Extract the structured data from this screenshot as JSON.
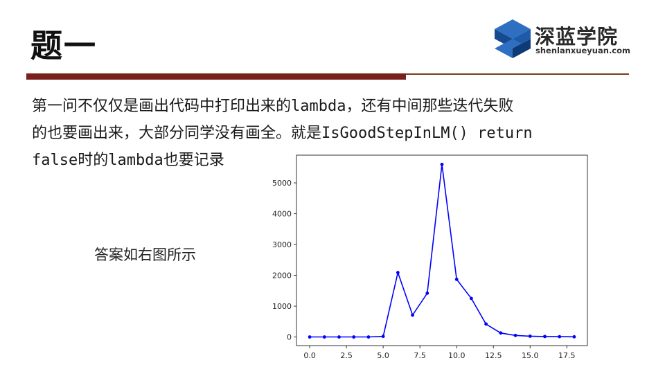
{
  "header": {
    "title": "题一",
    "logo_name": "深蓝学院",
    "logo_url_text": "shenlanxueyuan.com"
  },
  "paragraph": {
    "line1": "第一问不仅仅是画出代码中打印出来的lambda，还有中间那些迭代失败",
    "line2": "的也要画出来，大部分同学没有画全。就是IsGoodStepInLM() return",
    "line3": "false时的lambda也要记录"
  },
  "caption": "答案如右图所示",
  "colors": {
    "accent": "#7a1f1b",
    "series": "#0000ff",
    "logo_blue": "#1e5aa8"
  },
  "chart_data": {
    "type": "line",
    "x": [
      0,
      1,
      2,
      3,
      4,
      5,
      6,
      7,
      8,
      9,
      10,
      11,
      12,
      13,
      14,
      15,
      16,
      17,
      18
    ],
    "series": [
      {
        "values": [
          0,
          0,
          0,
          0,
          0,
          20,
          2090,
          710,
          1420,
          5600,
          1870,
          1250,
          420,
          130,
          50,
          25,
          15,
          10,
          5
        ]
      }
    ],
    "xlim": [
      -0.9,
      18.9
    ],
    "ylim": [
      -280,
      5900
    ],
    "xticks": [
      0,
      2.5,
      5,
      7.5,
      10,
      12.5,
      15,
      17.5
    ],
    "xtick_labels": [
      "0.0",
      "2.5",
      "5.0",
      "7.5",
      "10.0",
      "12.5",
      "15.0",
      "17.5"
    ],
    "yticks": [
      0,
      1000,
      2000,
      3000,
      4000,
      5000
    ],
    "ytick_labels": [
      "0",
      "1000",
      "2000",
      "3000",
      "4000",
      "5000"
    ],
    "markers": true,
    "grid": false
  }
}
